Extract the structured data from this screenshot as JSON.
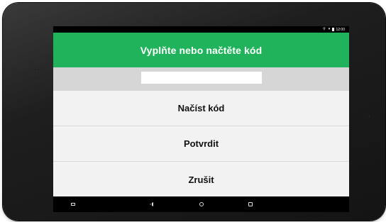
{
  "status_bar": {
    "time": "12:00",
    "icons": [
      "location-icon",
      "wifi-icon",
      "battery-icon"
    ]
  },
  "toolbar": {
    "title": "Vyplňte nebo načtěte kód"
  },
  "code_input": {
    "value": "",
    "placeholder": ""
  },
  "actions": {
    "load_label": "Načíst kód",
    "confirm_label": "Potvrdit",
    "cancel_label": "Zrušit"
  },
  "navigation": {
    "icons": [
      "menu-icon",
      "back-icon",
      "home-icon",
      "recent-apps-icon"
    ]
  },
  "colors": {
    "toolbar": "#21b35b",
    "input_strip": "#d6d6d6",
    "background": "#f2f2f2",
    "bezel": "#1e1e1e"
  }
}
